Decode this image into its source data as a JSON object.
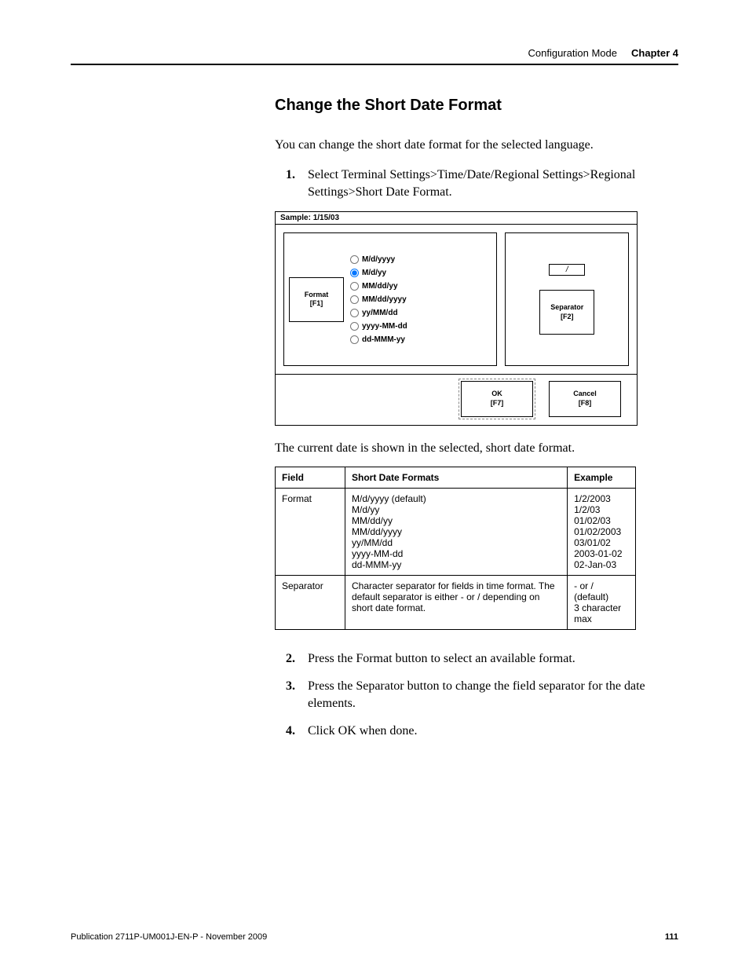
{
  "running_header": {
    "left": "Configuration Mode",
    "right": "Chapter 4"
  },
  "section_title": "Change the Short Date Format",
  "intro": "You can change the short date format for the selected language.",
  "steps_a": [
    {
      "n": "1.",
      "text": "Select Terminal Settings>Time/Date/Regional Settings>Regional Settings>Short Date Format."
    }
  ],
  "dialog": {
    "sample_label": "Sample:",
    "sample_value": "1/15/03",
    "format_btn_line1": "Format",
    "format_btn_line2": "[F1]",
    "radios": [
      "M/d/yyyy",
      "M/d/yy",
      "MM/dd/yy",
      "MM/dd/yyyy",
      "yy/MM/dd",
      "yyyy-MM-dd",
      "dd-MMM-yy"
    ],
    "selected_index": 1,
    "separator_value": "/",
    "separator_btn_line1": "Separator",
    "separator_btn_line2": "[F2]",
    "ok_line1": "OK",
    "ok_line2": "[F7]",
    "cancel_line1": "Cancel",
    "cancel_line2": "[F8]"
  },
  "caption": "The current date is shown in the selected, short date format.",
  "table": {
    "headers": [
      "Field",
      "Short Date Formats",
      "Example"
    ],
    "rows": [
      {
        "field": "Format",
        "formats": [
          "M/d/yyyy (default)",
          "M/d/yy",
          "MM/dd/yy",
          "MM/dd/yyyy",
          "yy/MM/dd",
          "yyyy-MM-dd",
          "dd-MMM-yy"
        ],
        "examples": [
          "1/2/2003",
          "1/2/03",
          "01/02/03",
          "01/02/2003",
          "03/01/02",
          "2003-01-02",
          "02-Jan-03"
        ]
      },
      {
        "field": "Separator",
        "desc": "Character separator for fields in time format. The default separator is either - or / depending on short date format.",
        "example_lines": [
          "-  or / (default)",
          "3 character max"
        ]
      }
    ]
  },
  "steps_b": [
    {
      "n": "2.",
      "text": "Press the Format button to select an available format."
    },
    {
      "n": "3.",
      "text": "Press the Separator button to change the field separator for the date elements."
    },
    {
      "n": "4.",
      "text": "Click OK when done."
    }
  ],
  "footer": {
    "pub": "Publication 2711P-UM001J-EN-P - November 2009",
    "page": "111"
  }
}
